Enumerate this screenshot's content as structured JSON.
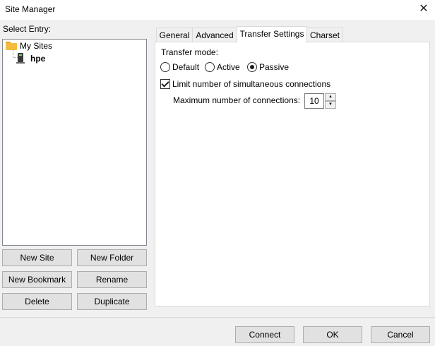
{
  "window": {
    "title": "Site Manager",
    "close_glyph": "✕"
  },
  "left": {
    "select_label": "Select Entry:",
    "tree": [
      {
        "label": "My Sites",
        "icon": "folder-icon"
      },
      {
        "label": "hpe",
        "icon": "server-icon"
      }
    ],
    "buttons": {
      "new_site": "New Site",
      "new_folder": "New Folder",
      "new_bookmark": "New Bookmark",
      "rename": "Rename",
      "delete": "Delete",
      "duplicate": "Duplicate"
    }
  },
  "tabs": [
    {
      "label": "General",
      "active": false
    },
    {
      "label": "Advanced",
      "active": false
    },
    {
      "label": "Transfer Settings",
      "active": true
    },
    {
      "label": "Charset",
      "active": false
    }
  ],
  "transfer": {
    "mode_label": "Transfer mode:",
    "modes": [
      {
        "label": "Default",
        "selected": false
      },
      {
        "label": "Active",
        "selected": false
      },
      {
        "label": "Passive",
        "selected": true
      }
    ],
    "limit_label": "Limit number of simultaneous connections",
    "limit_checked": true,
    "max_label": "Maximum number of connections:",
    "max_value": "10"
  },
  "footer": {
    "connect": "Connect",
    "ok": "OK",
    "cancel": "Cancel"
  }
}
